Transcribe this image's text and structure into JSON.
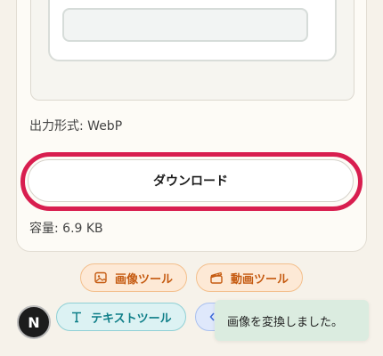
{
  "result": {
    "format_label": "出力形式: WebP",
    "download_label": "ダウンロード",
    "size_label": "容量: 6.9 KB"
  },
  "tools": [
    {
      "label": "画像ツール",
      "icon": "image-icon",
      "color": "#c55a10"
    },
    {
      "label": "動画ツール",
      "icon": "clapperboard-icon",
      "color": "#c55a10"
    },
    {
      "label": "テキストツール",
      "icon": "text-icon",
      "color": "#0e7e88"
    },
    {
      "label": "",
      "icon": "code-icon",
      "color": "#3d6bd8"
    }
  ],
  "avatar": {
    "initial": "N"
  },
  "toast": {
    "message": "画像を変換しました。"
  },
  "colors": {
    "highlight": "#d81e4f",
    "toast_bg": "#dbece0"
  }
}
